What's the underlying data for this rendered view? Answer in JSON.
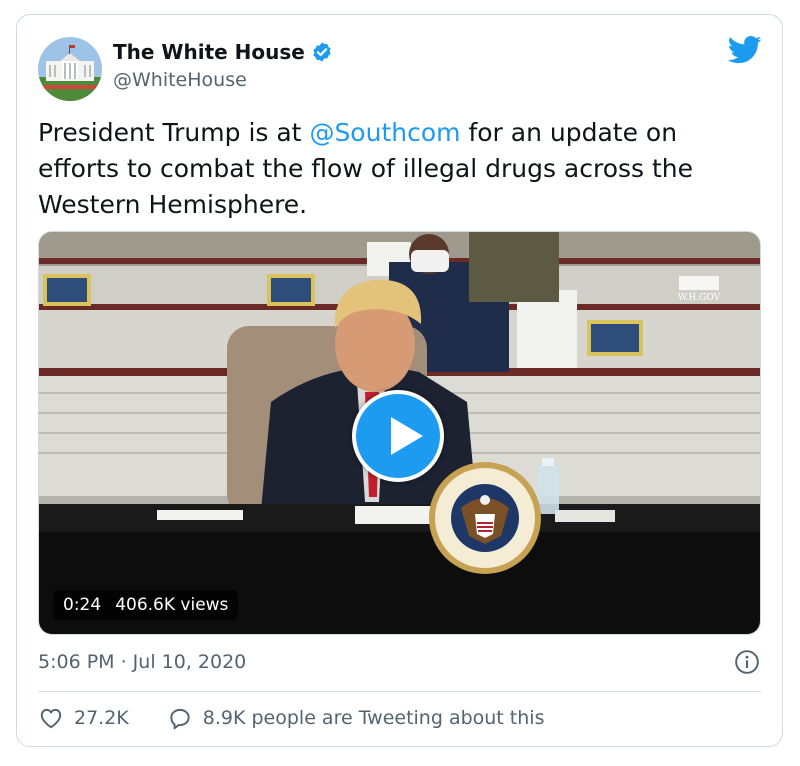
{
  "author": {
    "name": "The White House",
    "handle": "@WhiteHouse"
  },
  "tweet": {
    "text_before": "President Trump is at ",
    "mention": "@Southcom",
    "text_after": " for an update on efforts to combat the flow of illegal drugs across the Western Hemisphere."
  },
  "video": {
    "duration": "0:24",
    "views": "406.6K views",
    "watermark": "W.H.GOV",
    "seal_text": "SEAL OF THE PRESIDENT OF THE UNITED STATES"
  },
  "timestamp": "5:06 PM · Jul 10, 2020",
  "actions": {
    "likes": "27.2K",
    "conversation": "8.9K people are Tweeting about this"
  },
  "colors": {
    "accent": "#1d9bf0",
    "text": "#0f1419",
    "secondary": "#536471",
    "border": "#cfd9de"
  },
  "icons": {
    "verified": "verified-badge-icon",
    "brand": "twitter-bird-icon",
    "info": "info-icon",
    "like": "heart-icon",
    "reply": "speech-bubble-icon",
    "play": "play-icon"
  }
}
